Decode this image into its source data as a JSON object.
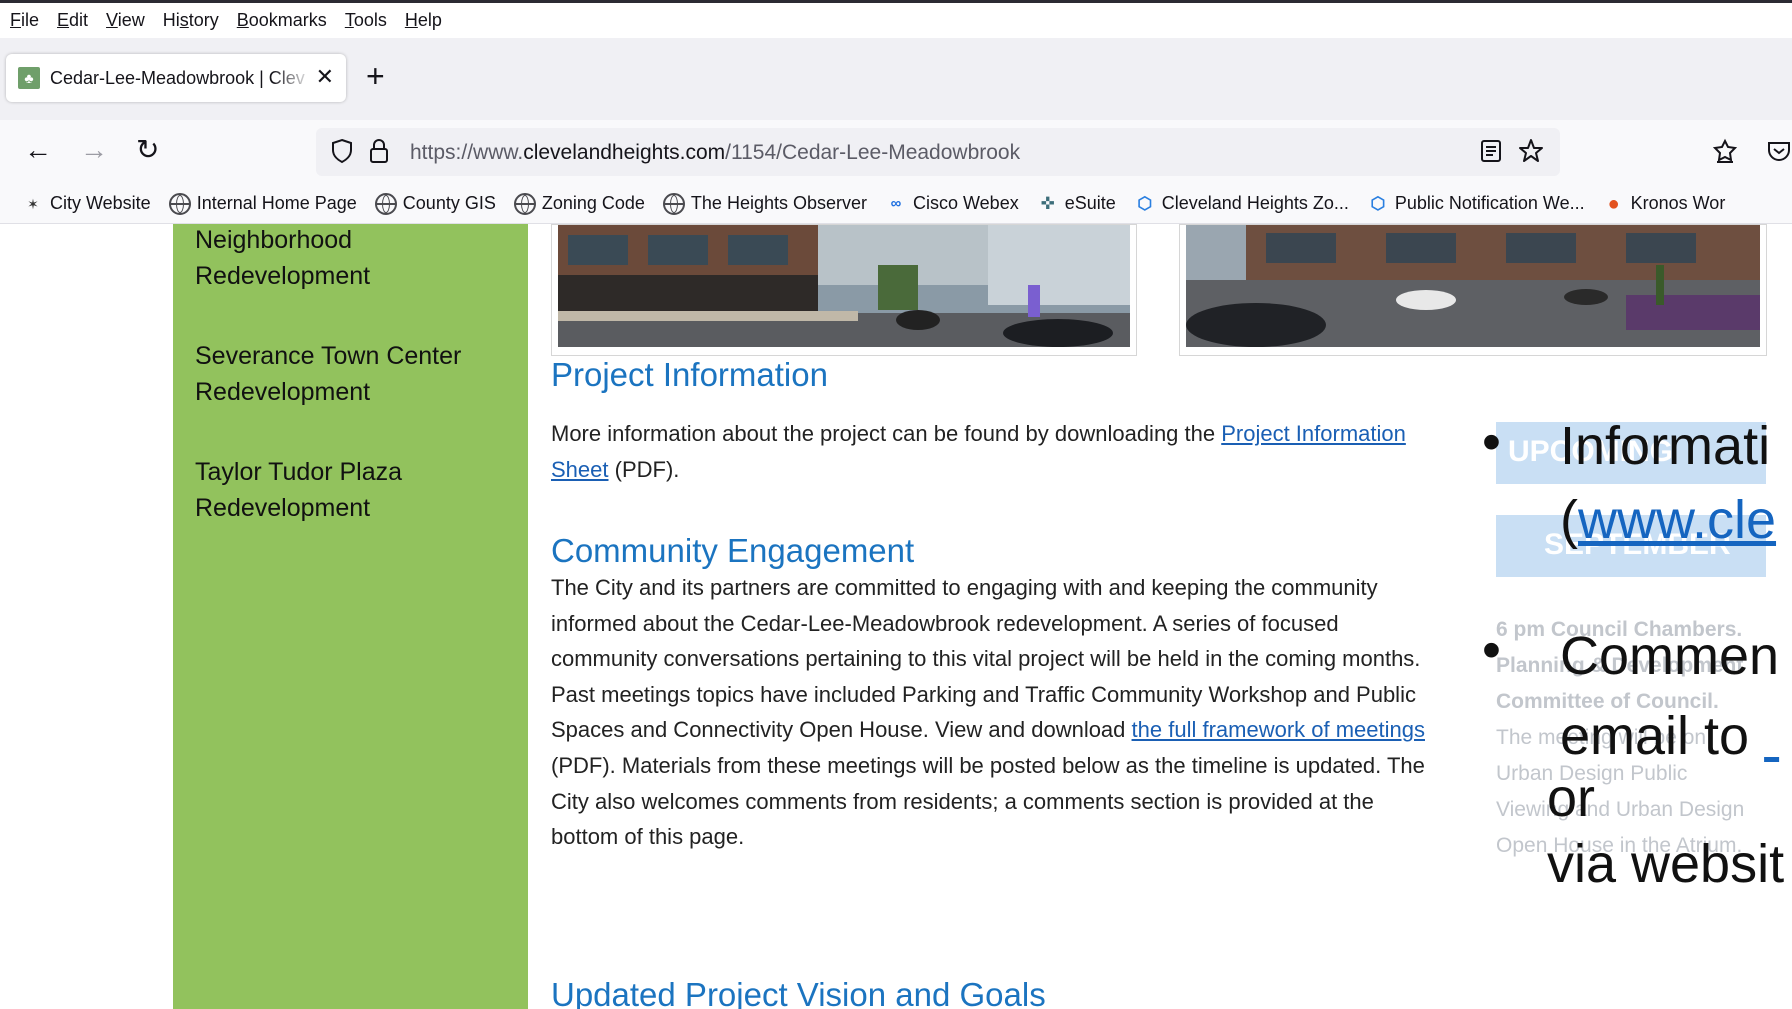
{
  "menu": [
    "File",
    "Edit",
    "View",
    "History",
    "Bookmarks",
    "Tools",
    "Help"
  ],
  "menu_underline": [
    "F",
    "E",
    "V",
    "s",
    "B",
    "T",
    "H"
  ],
  "tab": {
    "title": "Cedar-Lee-Meadowbrook | Clev",
    "close": "✕",
    "new_tab": "+"
  },
  "nav": {
    "back": "←",
    "forward": "→",
    "reload": "↻"
  },
  "url": {
    "prefix": "https://www.",
    "domain": "clevelandheights.com",
    "path": "/1154/Cedar-Lee-Meadowbrook"
  },
  "bookmarks": [
    {
      "label": "City Website",
      "icon": "star-icon"
    },
    {
      "label": "Internal Home Page",
      "icon": "globe-icon"
    },
    {
      "label": "County GIS",
      "icon": "globe-icon"
    },
    {
      "label": "Zoning Code",
      "icon": "globe-icon"
    },
    {
      "label": "The Heights Observer",
      "icon": "globe-icon"
    },
    {
      "label": "Cisco Webex",
      "icon": "webex-icon"
    },
    {
      "label": "eSuite",
      "icon": "esuite-icon"
    },
    {
      "label": "Cleveland Heights Zo...",
      "icon": "hex-icon"
    },
    {
      "label": "Public Notification We...",
      "icon": "hex-icon"
    },
    {
      "label": "Kronos Wor",
      "icon": "kronos-icon"
    }
  ],
  "sidebar": {
    "items": [
      {
        "line1": "Neighborhood",
        "line2": "Redevelopment"
      },
      {
        "line1": "Severance Town Center",
        "line2": "Redevelopment"
      },
      {
        "line1": "Taylor Tudor Plaza",
        "line2": "Redevelopment"
      }
    ]
  },
  "main": {
    "project_info": {
      "heading": "Project Information",
      "text_before": "More information about the project can be found by downloading the ",
      "link_line1": "Project Information",
      "link_line2": "Sheet",
      "text_after": " (PDF)."
    },
    "community": {
      "heading": "Community Engagement",
      "lines": [
        "The City and its partners are committed to engaging with and keeping the community",
        "informed about the Cedar-Lee-Meadowbrook redevelopment. A series of focused",
        "community conversations pertaining to this vital project will be held in the coming months.",
        "Past meetings topics have included Parking and Traffic Community Workshop and Public",
        "Spaces and Connectivity Open House. View and download "
      ],
      "link": "the full framework of meetings",
      "lines_after": [
        "(PDF). Materials from these meetings will be posted below as the timeline is updated. The",
        "City also welcomes comments from residents; a comments section is provided at the",
        "bottom of this page."
      ]
    },
    "vision": {
      "heading": "Updated Project Vision and Goals"
    }
  },
  "right_faded": {
    "box1": "UPCOMING",
    "box2": "SEPTEMBER",
    "bold1": "6 pm Council Chambers.",
    "bold2": "Planning & Development",
    "bold3": "Committee of Council.",
    "lines": [
      "The meeting will be on",
      "Urban Design Public",
      "Viewing and Urban Design",
      "Open House in the Atrium."
    ]
  },
  "slide": {
    "bullet": "•",
    "b1_text": "Informati",
    "b1_link_open": "(",
    "b1_link": "www.cle",
    "b2_text": "Commen",
    "b2_line2": "email to ",
    "b2_line3": "or",
    "b2_line4": "via websit"
  }
}
